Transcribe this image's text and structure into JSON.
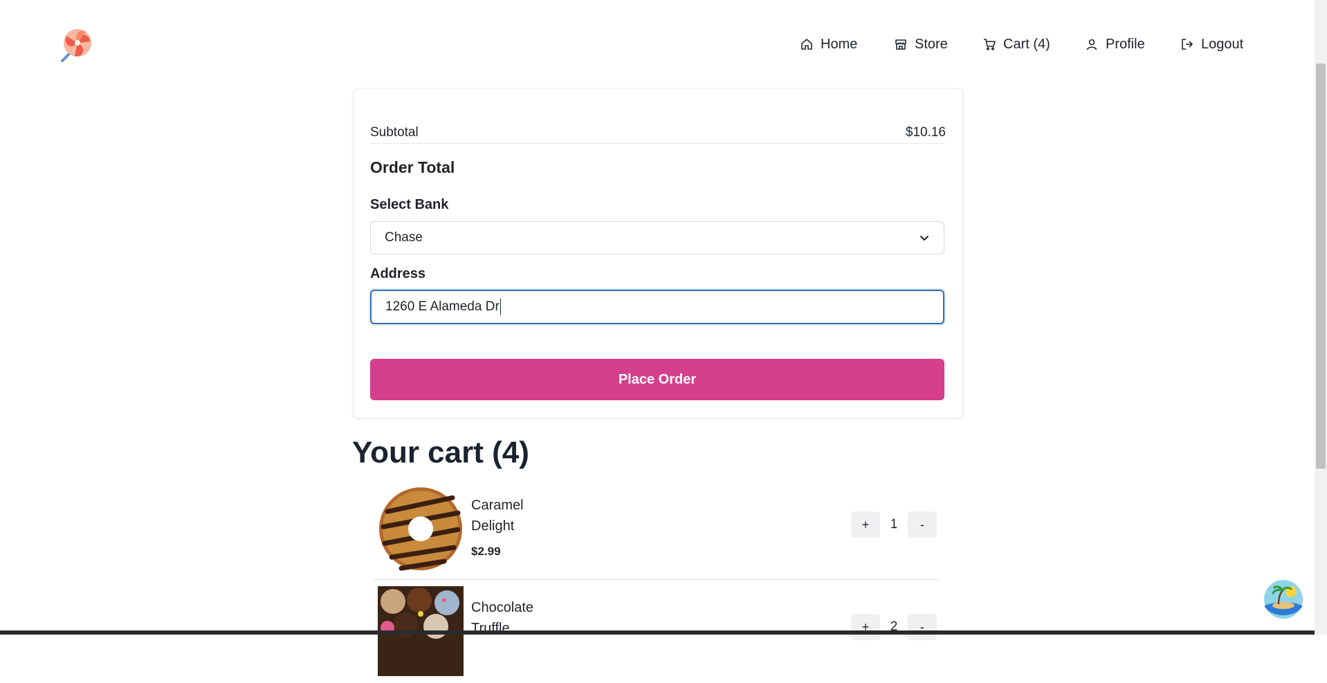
{
  "header": {
    "logo_name": "lollipop-logo",
    "nav": [
      {
        "label": "Home",
        "icon": "home-icon"
      },
      {
        "label": "Store",
        "icon": "store-icon"
      },
      {
        "label": "Cart (4)",
        "icon": "cart-icon"
      },
      {
        "label": "Profile",
        "icon": "user-icon"
      },
      {
        "label": "Logout",
        "icon": "logout-icon"
      }
    ]
  },
  "checkout": {
    "subtotal_label": "Subtotal",
    "subtotal_value": "$10.16",
    "order_total_label": "Order Total",
    "bank_label": "Select Bank",
    "bank_selected": "Chase",
    "address_label": "Address",
    "address_value": "1260 E Alameda Dr",
    "place_order_label": "Place Order"
  },
  "cart": {
    "title": "Your cart (4)",
    "items": [
      {
        "name": "Caramel Delight",
        "price": "$2.99",
        "qty": "1",
        "plus": "+",
        "minus": "-"
      },
      {
        "name": "Chocolate Truffle",
        "price": "",
        "qty": "2",
        "plus": "+",
        "minus": "-"
      }
    ]
  },
  "colors": {
    "accent": "#d63f8c",
    "focus": "#2f6fb5"
  }
}
